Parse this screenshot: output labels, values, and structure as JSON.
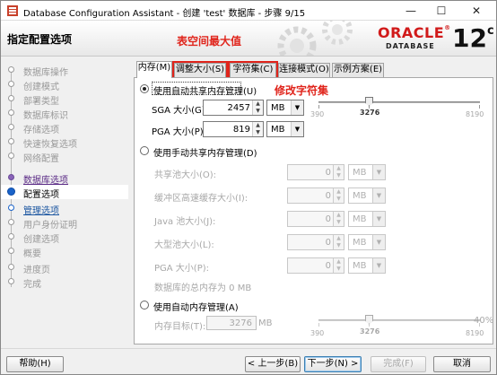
{
  "window": {
    "title": "Database Configuration Assistant - 创建 'test' 数据库 - 步骤 9/15",
    "minimize": "—",
    "maximize": "☐",
    "close": "✕"
  },
  "header": {
    "page_title": "指定配置选项",
    "annotation_top": "表空间最大值",
    "brand": "ORACLE",
    "brand_registered": "®",
    "brand_sub": "DATABASE",
    "version": "12",
    "version_suffix": "c",
    "brand_color": "#d11a1a"
  },
  "nav": {
    "items": [
      {
        "label": "数据库操作",
        "state": "done"
      },
      {
        "label": "创建模式",
        "state": "done"
      },
      {
        "label": "部署类型",
        "state": "done"
      },
      {
        "label": "数据库标识",
        "state": "done"
      },
      {
        "label": "存储选项",
        "state": "done"
      },
      {
        "label": "快速恢复选项",
        "state": "done"
      },
      {
        "label": "网络配置",
        "state": "done"
      },
      {
        "label": "数据库选项",
        "state": "link"
      },
      {
        "label": "配置选项",
        "state": "current"
      },
      {
        "label": "管理选项",
        "state": "next"
      },
      {
        "label": "用户身份证明",
        "state": "pending"
      },
      {
        "label": "创建选项",
        "state": "pending"
      },
      {
        "label": "概要",
        "state": "pending"
      },
      {
        "label": "进度页",
        "state": "pending"
      },
      {
        "label": "完成",
        "state": "pending"
      }
    ]
  },
  "tabs": [
    {
      "label": "内存(M)",
      "active": true
    },
    {
      "label": "调整大小(S)",
      "highlight": true
    },
    {
      "label": "字符集(C)",
      "highlight": true
    },
    {
      "label": "连接模式(O)"
    },
    {
      "label": "示例方案(E)"
    }
  ],
  "annotation_charset": "修改字符集",
  "memory": {
    "auto_shared": {
      "label": "使用自动共享内存管理(U)",
      "checked": true,
      "sga_label": "SGA 大小(G):",
      "sga_value": "2457",
      "sga_unit": "MB",
      "pga_label": "PGA 大小(P):",
      "pga_value": "819",
      "pga_unit": "MB",
      "slider_min": "390",
      "slider_mid": "3276",
      "slider_max": "8190",
      "slider_value": 3276
    },
    "manual_shared": {
      "label": "使用手动共享内存管理(D)",
      "checked": false,
      "rows": [
        {
          "label": "共享池大小(O):",
          "value": "0",
          "unit": "MB"
        },
        {
          "label": "缓冲区高速缓存大小(I):",
          "value": "0",
          "unit": "MB"
        },
        {
          "label": "Java 池大小(J):",
          "value": "0",
          "unit": "MB"
        },
        {
          "label": "大型池大小(L):",
          "value": "0",
          "unit": "MB"
        },
        {
          "label": "PGA 大小(P):",
          "value": "0",
          "unit": "MB"
        }
      ],
      "total_label": "数据库的总内存为 0 MB"
    },
    "auto_memory": {
      "label": "使用自动内存管理(A)",
      "checked": false,
      "target_label": "内存目标(T):",
      "target_value": "3276",
      "target_unit": "MB",
      "slider_min": "390",
      "slider_mid": "3276",
      "slider_max": "8190",
      "percent": "40%",
      "slider_value": 3276
    }
  },
  "footer": {
    "help": "帮助(H)",
    "back": "< 上一步(B)",
    "next": "下一步(N) >",
    "finish": "完成(F)",
    "cancel": "取消"
  }
}
